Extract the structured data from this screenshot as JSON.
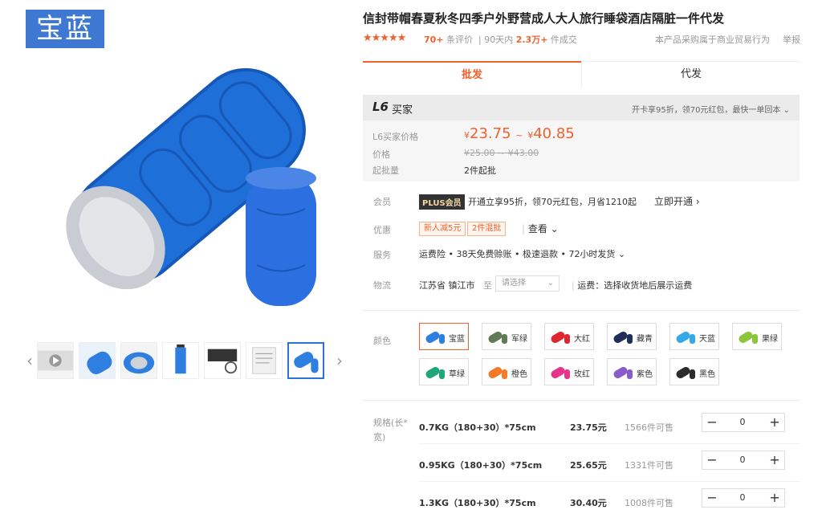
{
  "gallery": {
    "color_tag": "宝蓝",
    "thumbnail_count": 7
  },
  "product": {
    "title": "信封带帽春夏秋冬四季户外野营成人大人旅行睡袋酒店隔脏一件代发",
    "stars": "★★★★★",
    "review_count": "70+",
    "review_label": "条评价",
    "sales_prefix": "90天内",
    "sales_count": "2.3万+",
    "sales_suffix": "件成交",
    "trade_note": "本产品采购属于商业贸易行为",
    "report": "举报"
  },
  "tabs": {
    "wholesale": "批发",
    "dropship": "代发"
  },
  "price_box": {
    "level": "L6",
    "buyer": "买家",
    "head_right": "开卡享95折，领70元红包，最快一单回本",
    "price_label": "L6买家价格",
    "currency": "¥",
    "price_min": "23.75",
    "tilde": "~",
    "price_max": "40.85",
    "orig_label": "价格",
    "orig_price": "¥25.00 ~ ¥43.00",
    "moq_label": "起批量",
    "moq": "2件起批"
  },
  "member": {
    "label": "会员",
    "badge": "PLUS会员",
    "text": "开通立享95折，领70元红包，月省1210起",
    "open_now": "立即开通 ›"
  },
  "discount": {
    "label": "优惠",
    "coupons": [
      "新人减5元",
      "2件混批"
    ],
    "check_more": "查看 ⌄"
  },
  "service": {
    "label": "服务",
    "text": "运费险 • 38天免费赊账 • 极速退款 • 72小时发货 ⌄"
  },
  "logistics": {
    "label": "物流",
    "from": "江苏省 镇江市",
    "to": "至",
    "region_placeholder": "请选择",
    "fee": "运费：选择收货地后展示运费"
  },
  "colors": {
    "label": "颜色",
    "options": [
      {
        "name": "宝蓝",
        "hex": "#2f7fe0",
        "selected": true
      },
      {
        "name": "军绿",
        "hex": "#5f7a55",
        "selected": false
      },
      {
        "name": "大红",
        "hex": "#e0272f",
        "selected": false
      },
      {
        "name": "藏青",
        "hex": "#1f2f5a",
        "selected": false
      },
      {
        "name": "天蓝",
        "hex": "#37a9e6",
        "selected": false
      },
      {
        "name": "果绿",
        "hex": "#8cc63f",
        "selected": false
      },
      {
        "name": "草绿",
        "hex": "#1fa67a",
        "selected": false
      },
      {
        "name": "橙色",
        "hex": "#f47a2a",
        "selected": false
      },
      {
        "name": "玫红",
        "hex": "#e8338b",
        "selected": false
      },
      {
        "name": "紫色",
        "hex": "#8a5cc9",
        "selected": false
      },
      {
        "name": "黑色",
        "hex": "#2b2b2b",
        "selected": false
      }
    ]
  },
  "specs": {
    "label": "规格(长*宽)",
    "rows": [
      {
        "name": "0.7KG（180+30）*75cm",
        "price": "23.75元",
        "stock": "1566件可售",
        "qty": "0"
      },
      {
        "name": "0.95KG（180+30）*75cm",
        "price": "25.65元",
        "stock": "1331件可售",
        "qty": "0"
      },
      {
        "name": "1.3KG（180+30）*75cm",
        "price": "30.40元",
        "stock": "1008件可售",
        "qty": "0"
      }
    ],
    "minus": "−",
    "plus": "+"
  }
}
